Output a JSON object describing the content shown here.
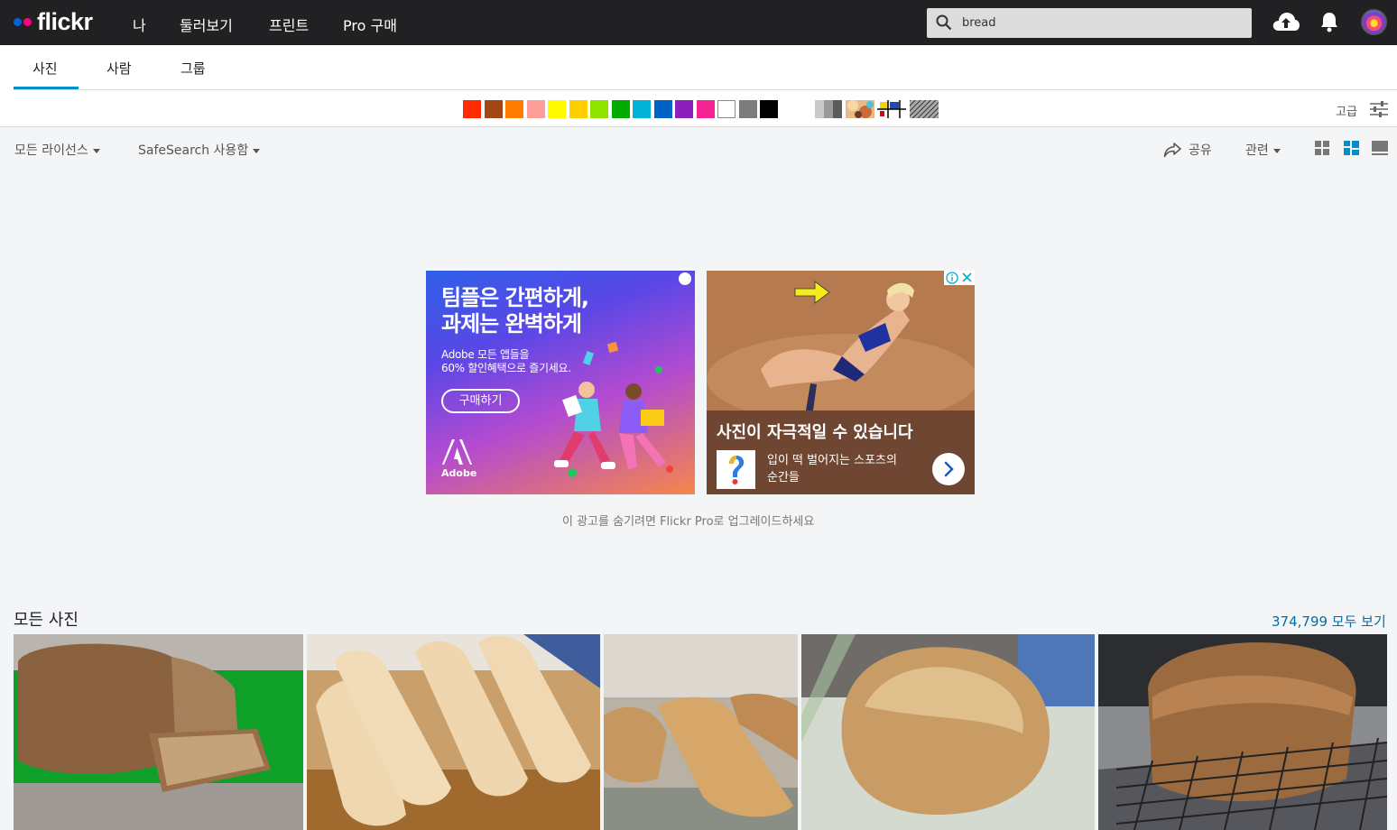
{
  "header": {
    "logo": "flickr",
    "nav": [
      "나",
      "둘러보기",
      "프린트",
      "Pro 구매"
    ],
    "search_value": "bread"
  },
  "tabs": [
    "사진",
    "사람",
    "그룹"
  ],
  "active_tab": "사진",
  "color_filters": {
    "colors": [
      "#ff2a00",
      "#a24615",
      "#ff7c00",
      "#ff9f9c",
      "#fffa00",
      "#ffcf00",
      "#90e200",
      "#00ab00",
      "#00b2d4",
      "#0062c6",
      "#8c20ba",
      "#f52394",
      "#ffffff",
      "#7c7c7c",
      "#000000"
    ],
    "patterns": [
      "black-and-white",
      "shallow-depth-of-field",
      "minimalist",
      "patterns"
    ],
    "advanced_label": "고급"
  },
  "filters": {
    "license": "모든 라이선스",
    "safesearch": "SafeSearch 사용함",
    "share": "공유",
    "sort": "관련",
    "view_modes": [
      "grid-small",
      "grid-justified",
      "single"
    ]
  },
  "ads": {
    "left": {
      "headline": "팀플은 간편하게,\n과제는 완벽하게",
      "sub": "Adobe 모든 앱들을\n60% 할인혜택으로 즐기세요.",
      "button": "구매하기",
      "brand": "Adobe"
    },
    "right": {
      "headline": "사진이 자극적일 수 있습니다",
      "sub": "입이 떡 벌어지는 스포츠의\n순간들"
    },
    "note": "이 광고를 숨기려면 Flickr Pro로 업그레이드하세요"
  },
  "results": {
    "title": "모든 사진",
    "count_link": "374,799 모두 보기"
  }
}
